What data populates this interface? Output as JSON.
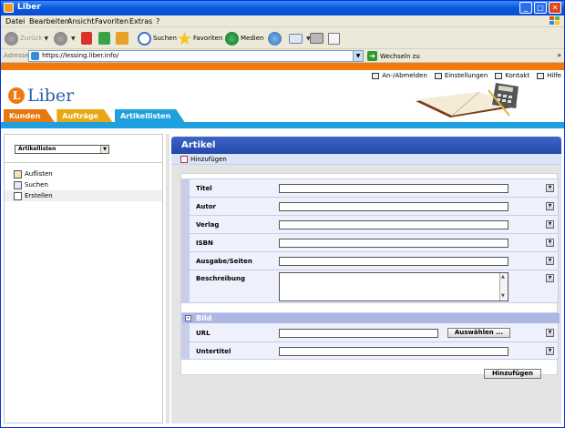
{
  "window": {
    "title": "Liber",
    "controls": [
      "_",
      "□",
      "✕"
    ]
  },
  "menu": [
    "Datei",
    "Bearbeiten",
    "Ansicht",
    "Favoriten",
    "Extras",
    "?"
  ],
  "toolbar": {
    "back": "Zurück",
    "search": "Suchen",
    "favorites": "Favoriten",
    "media": "Medien"
  },
  "address": {
    "label": "Adresse",
    "url": "https://lessing.liber.info/",
    "go": "Wechseln zu",
    "more": "»"
  },
  "header": {
    "links": [
      "An-/Abmelden",
      "Einstellungen",
      "Kontakt",
      "Hilfe"
    ],
    "logo_text": "Liber",
    "tabs": [
      "Kunden",
      "Aufträge",
      "Artikellisten"
    ]
  },
  "sidebar": {
    "select_value": "Artikellisten",
    "items": [
      "Auflisten",
      "Suchen",
      "Erstellen"
    ]
  },
  "main": {
    "title": "Artikel",
    "add_link": "Hinzufügen",
    "fields": [
      "Titel",
      "Autor",
      "Verlag",
      "ISBN",
      "Ausgabe/Seiten",
      "Beschreibung"
    ],
    "bild": {
      "title": "Bild",
      "url_label": "URL",
      "choose_button": "Auswählen ...",
      "subtitle_label": "Untertitel"
    },
    "submit": "Hinzufügen"
  },
  "colors": {
    "orange": "#f07a10",
    "blue": "#1fa0de",
    "panel_blue": "#2348a8"
  }
}
